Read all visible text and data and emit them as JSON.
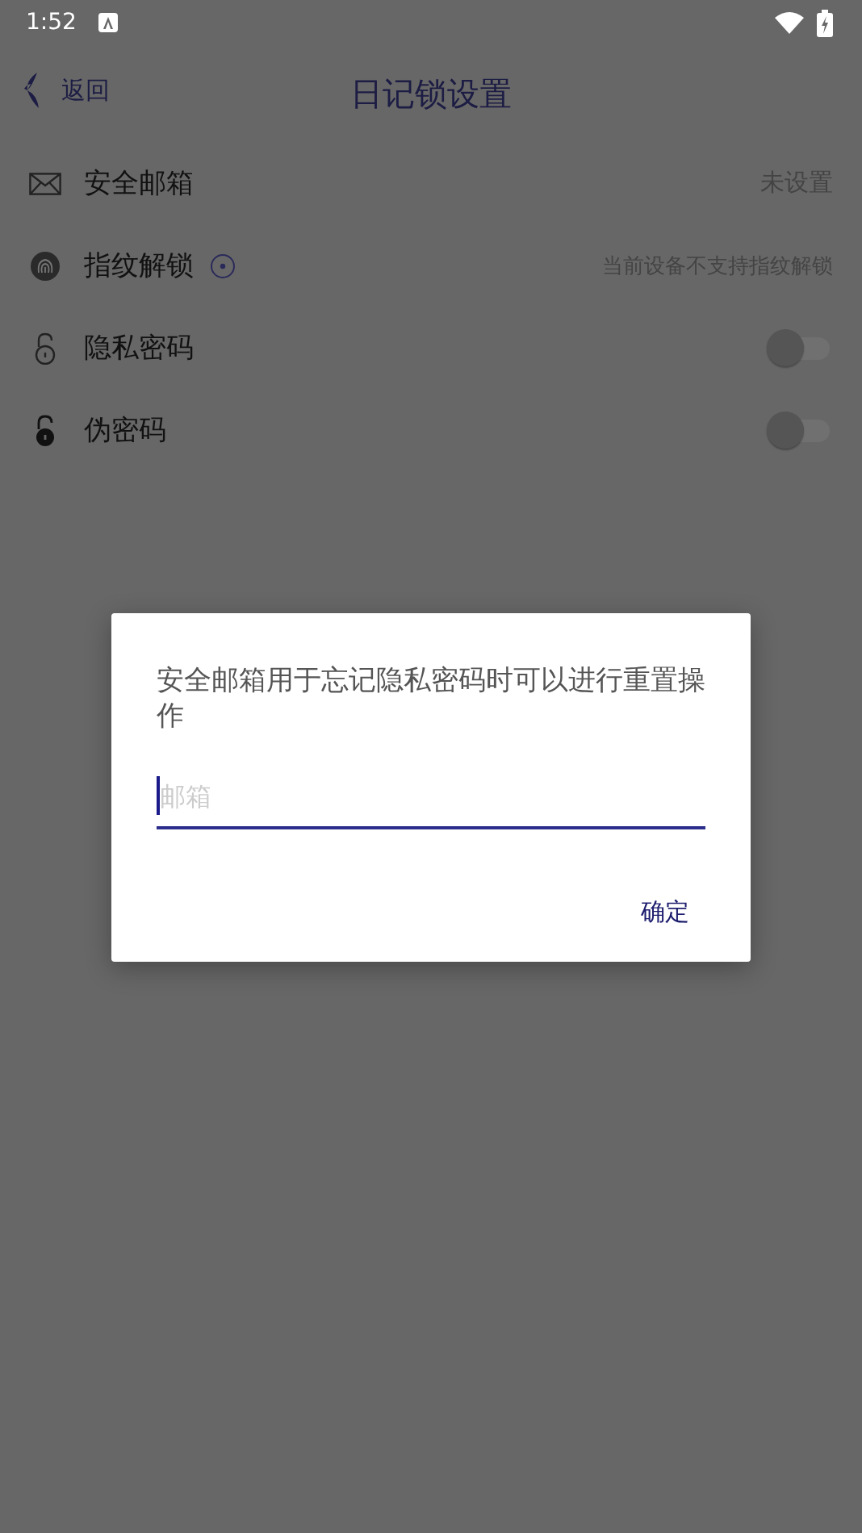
{
  "status_bar": {
    "time": "1:52"
  },
  "header": {
    "back": "返回",
    "title": "日记锁设置"
  },
  "settings": [
    {
      "kind": "value",
      "label": "安全邮箱",
      "value": "未设置",
      "info": false
    },
    {
      "kind": "value",
      "label": "指纹解锁",
      "value": "当前设备不支持指纹解锁",
      "info": true
    },
    {
      "kind": "switch",
      "label": "隐私密码",
      "on": false
    },
    {
      "kind": "switch",
      "label": "伪密码",
      "on": false
    }
  ],
  "dialog": {
    "message": "安全邮箱用于忘记隐私密码时可以进行重置操作",
    "field": {
      "placeholder": "邮箱"
    },
    "buttons": [
      "确定"
    ]
  }
}
